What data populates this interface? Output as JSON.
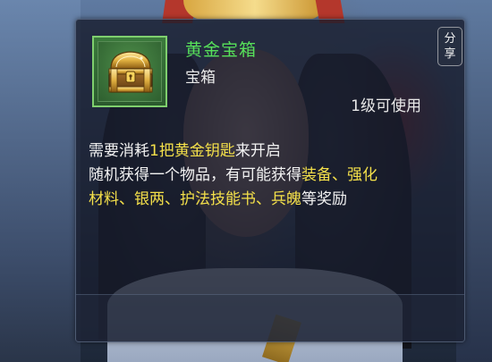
{
  "tooltip": {
    "item_name": "黄金宝箱",
    "item_type": "宝箱",
    "level_requirement": "1级可使用",
    "share_button": {
      "line1": "分",
      "line2": "享"
    },
    "description": {
      "line1": {
        "before": "需要消耗",
        "highlight": "1把黄金钥匙",
        "after": "来开启"
      },
      "line2": {
        "before": "随机获得一个物品，有可能获得",
        "hl1": "装备",
        "sep1": "、",
        "hl2": "强化"
      },
      "line3": {
        "hl3": "材料",
        "sep2": "、",
        "hl4": "银两",
        "sep3": "、",
        "hl5": "护法技能书",
        "sep4": "、",
        "hl6": "兵魄",
        "after": "等奖励"
      }
    },
    "item_icon": "golden-treasure-chest-icon",
    "rarity_color": "#57e05a",
    "highlight_color": "#f4e04a"
  }
}
